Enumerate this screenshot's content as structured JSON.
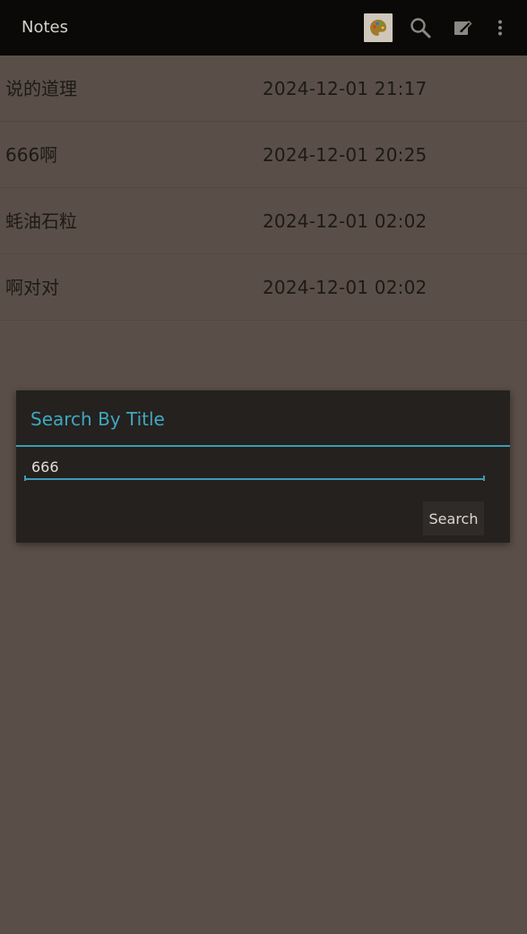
{
  "app_bar": {
    "title": "Notes",
    "actions": {
      "palette_icon": "palette-icon",
      "search_icon": "search-icon",
      "edit_icon": "edit-note-icon",
      "more_icon": "more-vert-icon"
    }
  },
  "notes": [
    {
      "title": "说的道理",
      "date": "2024-12-01 21:17"
    },
    {
      "title": "666啊",
      "date": "2024-12-01 20:25"
    },
    {
      "title": "蚝油石粒",
      "date": "2024-12-01 02:02"
    },
    {
      "title": "啊对对",
      "date": "2024-12-01 02:02"
    }
  ],
  "search_dialog": {
    "title": "Search By Title",
    "input_value": "666",
    "button_label": "Search"
  },
  "colors": {
    "background": "#5a4f48",
    "app_bar": "#0a0908",
    "dialog": "#24211f",
    "accent": "#3fa8bf"
  }
}
